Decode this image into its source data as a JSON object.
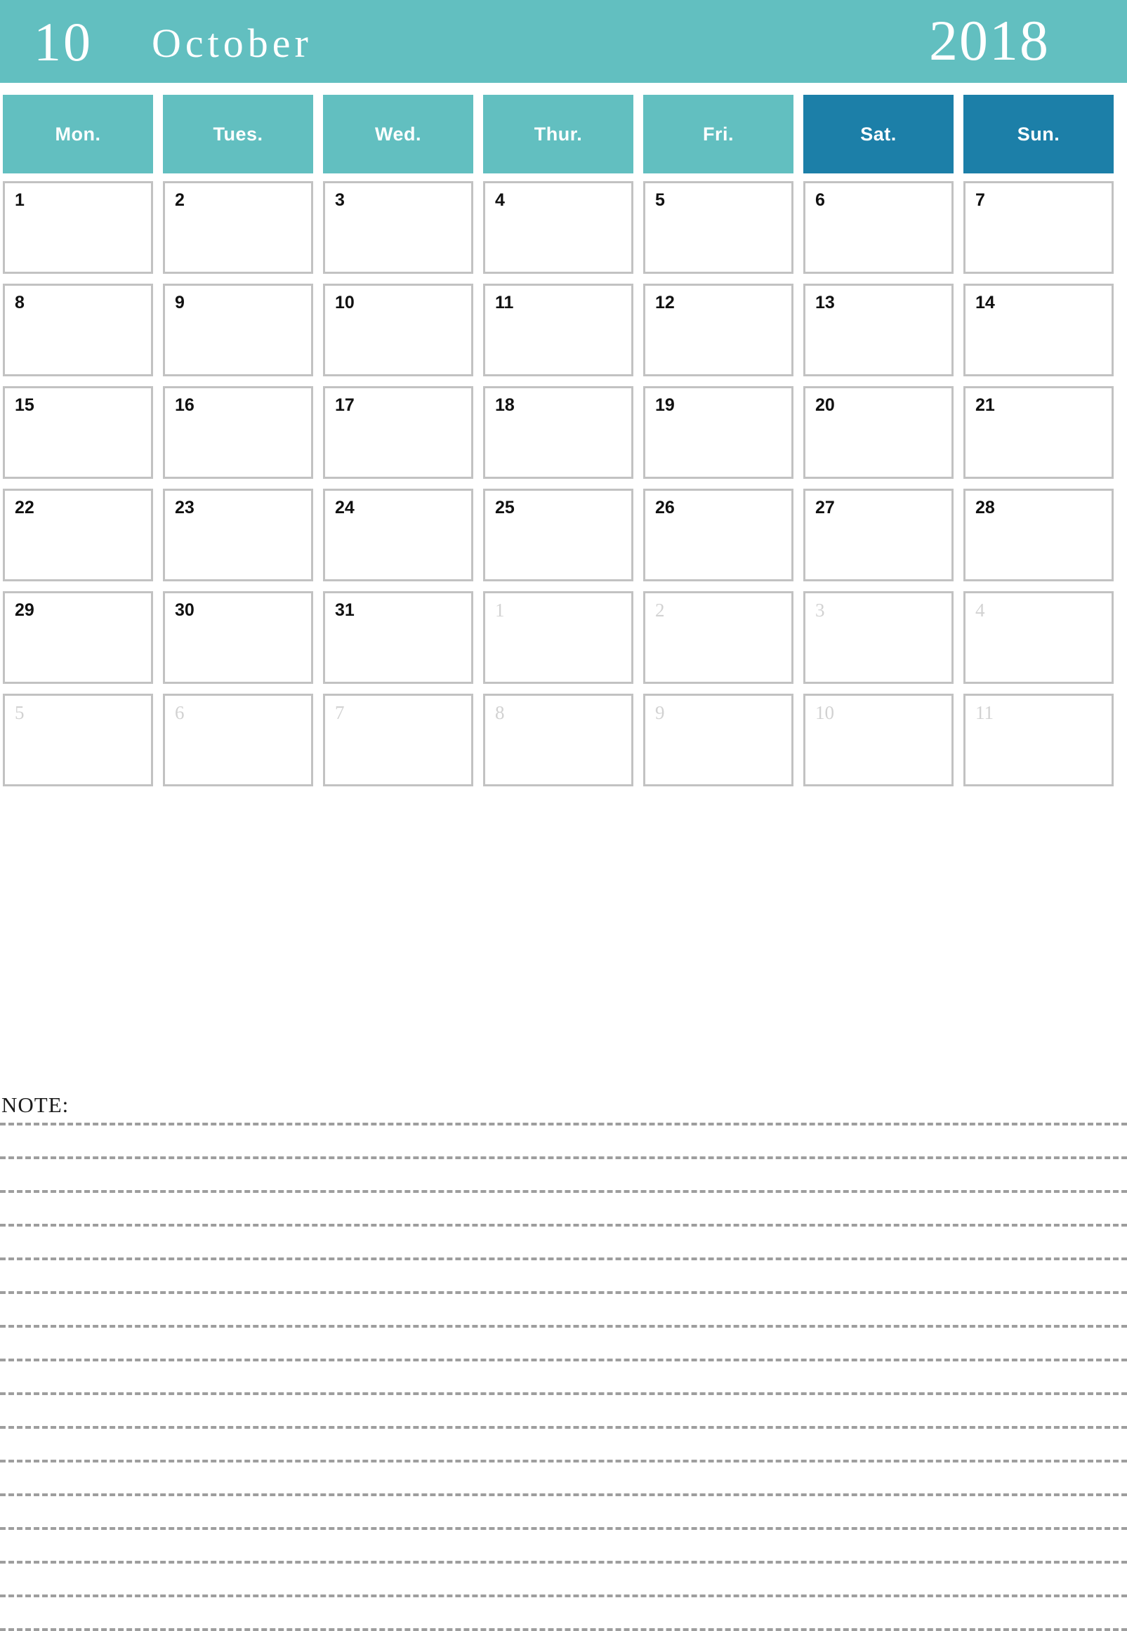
{
  "header": {
    "month_number": "10",
    "month_name": "October",
    "year": "2018",
    "background_color": "#62bfc0",
    "text_color": "#ffffff"
  },
  "weekdays": [
    {
      "label": "Mon.",
      "type": "weekday"
    },
    {
      "label": "Tues.",
      "type": "weekday"
    },
    {
      "label": "Wed.",
      "type": "weekday"
    },
    {
      "label": "Thur.",
      "type": "weekday"
    },
    {
      "label": "Fri.",
      "type": "weekday"
    },
    {
      "label": "Sat.",
      "type": "weekend"
    },
    {
      "label": "Sun.",
      "type": "weekend"
    }
  ],
  "colors": {
    "weekday_header": "#62bfc0",
    "weekend_header": "#1c7fa8",
    "cell_border": "#c2c2c2",
    "current_month_text": "#111111",
    "outside_month_text": "#d2d2d2",
    "note_line": "#9e9e9e"
  },
  "grid": {
    "rows": [
      [
        {
          "day": "1",
          "outside": false
        },
        {
          "day": "2",
          "outside": false
        },
        {
          "day": "3",
          "outside": false
        },
        {
          "day": "4",
          "outside": false
        },
        {
          "day": "5",
          "outside": false
        },
        {
          "day": "6",
          "outside": false
        },
        {
          "day": "7",
          "outside": false
        }
      ],
      [
        {
          "day": "8",
          "outside": false
        },
        {
          "day": "9",
          "outside": false
        },
        {
          "day": "10",
          "outside": false
        },
        {
          "day": "11",
          "outside": false
        },
        {
          "day": "12",
          "outside": false
        },
        {
          "day": "13",
          "outside": false
        },
        {
          "day": "14",
          "outside": false
        }
      ],
      [
        {
          "day": "15",
          "outside": false
        },
        {
          "day": "16",
          "outside": false
        },
        {
          "day": "17",
          "outside": false
        },
        {
          "day": "18",
          "outside": false
        },
        {
          "day": "19",
          "outside": false
        },
        {
          "day": "20",
          "outside": false
        },
        {
          "day": "21",
          "outside": false
        }
      ],
      [
        {
          "day": "22",
          "outside": false
        },
        {
          "day": "23",
          "outside": false
        },
        {
          "day": "24",
          "outside": false
        },
        {
          "day": "25",
          "outside": false
        },
        {
          "day": "26",
          "outside": false
        },
        {
          "day": "27",
          "outside": false
        },
        {
          "day": "28",
          "outside": false
        }
      ],
      [
        {
          "day": "29",
          "outside": false
        },
        {
          "day": "30",
          "outside": false
        },
        {
          "day": "31",
          "outside": false
        },
        {
          "day": "1",
          "outside": true
        },
        {
          "day": "2",
          "outside": true
        },
        {
          "day": "3",
          "outside": true
        },
        {
          "day": "4",
          "outside": true
        }
      ],
      [
        {
          "day": "5",
          "outside": true
        },
        {
          "day": "6",
          "outside": true
        },
        {
          "day": "7",
          "outside": true
        },
        {
          "day": "8",
          "outside": true
        },
        {
          "day": "9",
          "outside": true
        },
        {
          "day": "10",
          "outside": true
        },
        {
          "day": "11",
          "outside": true
        }
      ]
    ]
  },
  "note": {
    "label": "NOTE:",
    "line_count": 16
  }
}
